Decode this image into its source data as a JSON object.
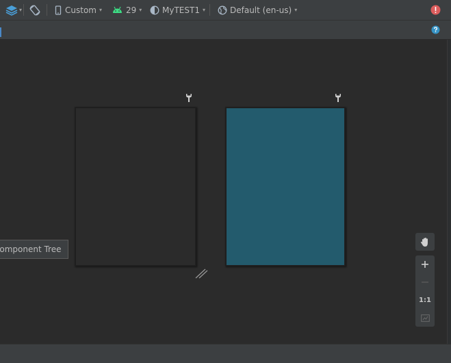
{
  "toolbar": {
    "device_label": "Custom",
    "api_label": "29",
    "theme_label": "MyTEST1",
    "locale_label": "Default (en-us)"
  },
  "panel": {
    "component_tree_label": "Component Tree"
  },
  "zoom": {
    "one_to_one_label": "1:1"
  },
  "colors": {
    "design_surface": "#235b6d",
    "blueprint_surface": "#2b2b2b",
    "error_badge": "#db5c5c",
    "help_badge": "#3592c4",
    "android_green": "#3ddc84"
  }
}
